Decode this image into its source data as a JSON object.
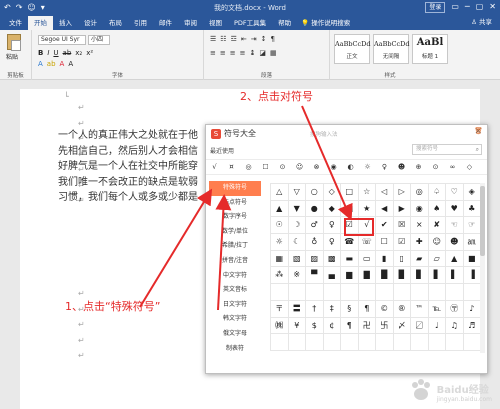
{
  "window": {
    "qat": [
      "↶",
      "↷",
      "☺",
      "▾"
    ],
    "title": "我的文档.docx - Word",
    "login": "登录",
    "controls": [
      "▭",
      "─",
      "▢",
      "✕"
    ]
  },
  "ribbon_tabs": [
    {
      "label": "文件"
    },
    {
      "label": "开始",
      "active": true
    },
    {
      "label": "插入"
    },
    {
      "label": "设计"
    },
    {
      "label": "布局"
    },
    {
      "label": "引用"
    },
    {
      "label": "邮件"
    },
    {
      "label": "审阅"
    },
    {
      "label": "视图"
    },
    {
      "label": "PDF工具集"
    },
    {
      "label": "帮助"
    }
  ],
  "tell_me": "操作说明搜索",
  "share": "共享",
  "ribbon": {
    "clipboard_label": "剪贴板",
    "paste_label": "粘贴",
    "font_name": "Segoe UI Syr",
    "font_size": "小四",
    "font_group_label": "字体",
    "paragraph_group_label": "段落",
    "styles": [
      {
        "sample": "AaBbCcDd",
        "name": "正文"
      },
      {
        "sample": "AaBbCcDd",
        "name": "无间隔"
      },
      {
        "sample": "AaBl",
        "name": "标题 1"
      }
    ],
    "styles_group_label": "样式"
  },
  "document": {
    "lines": [
      "一个人的真正伟大之处就在于他",
      "先相信自己，然后别人才会相信",
      "好脾气是一个人在社交中所能穿",
      "我们唯一不会改正的缺点是软弱",
      "习惯，我们每个人或多或少都是"
    ],
    "para_marks": [
      "↵",
      "↵",
      "↵",
      "↵",
      "↵",
      "↵",
      "↵",
      "↵",
      "↵",
      "↵",
      "↵",
      "↵",
      "↵",
      "↵",
      "↵",
      "↵",
      "↵"
    ]
  },
  "dialog": {
    "title": "符号大全",
    "input_hint": "搜狗输入法",
    "close": "✕",
    "recent_label": "最近使用",
    "search_placeholder": "搜索符号",
    "recent_symbols": [
      "√",
      "¤",
      "◎",
      "☐",
      "⊙",
      "☺",
      "⊗",
      "◉",
      "◐",
      "☼",
      "♀",
      "☻",
      "⊕",
      "⊙",
      "∞",
      "◇"
    ],
    "categories": [
      {
        "label": "特殊符号",
        "active": true
      },
      {
        "label": "标点符号"
      },
      {
        "label": "数字序号"
      },
      {
        "label": "数学/单位"
      },
      {
        "label": "希腊/拉丁"
      },
      {
        "label": "拼音/注音"
      },
      {
        "label": "中文字符"
      },
      {
        "label": "英文音标"
      },
      {
        "label": "日文字符"
      },
      {
        "label": "韩文字符"
      },
      {
        "label": "俄文字母"
      },
      {
        "label": "制表符"
      }
    ],
    "symbols": [
      [
        "△",
        "▽",
        "○",
        "◇",
        "□",
        "☆",
        "◁",
        "▷",
        "◎",
        "♤",
        "♡",
        "◈"
      ],
      [
        "▲",
        "▼",
        "●",
        "◆",
        "■",
        "★",
        "◀",
        "▶",
        "◉",
        "♠",
        "♥",
        "♣"
      ],
      [
        "☉",
        "☽",
        "♂",
        "♀",
        "☑",
        "√",
        "✔",
        "☒",
        "×",
        "✘",
        "☜",
        "☞"
      ],
      [
        "☼",
        "☾",
        "♁",
        "♀",
        "☎",
        "☏",
        "☐",
        "☑",
        "✚",
        "☺",
        "☻",
        "㏂"
      ],
      [
        "▦",
        "▧",
        "▨",
        "▩",
        "▬",
        "▭",
        "▮",
        "▯",
        "▰",
        "▱",
        "▲",
        "■"
      ],
      [
        "⁂",
        "※",
        "▀",
        "▄",
        "▆",
        "▇",
        "█",
        "▉",
        "▊",
        "▋",
        "▌",
        "▐"
      ],
      [
        "",
        "",
        "",
        "",
        "",
        "",
        "",
        "",
        "",
        "",
        "",
        ""
      ],
      [
        "〒",
        "〓",
        "†",
        "‡",
        "§",
        "¶",
        "©",
        "®",
        "™",
        "℡",
        "〶",
        "♪"
      ],
      [
        "㈱",
        "¥",
        "$",
        "¢",
        "¶",
        "卍",
        "卐",
        "〆",
        "〼",
        "♩",
        "♫",
        "♬"
      ],
      [
        "",
        "",
        "",
        "",
        "",
        "",
        "",
        "",
        "",
        "",
        "",
        ""
      ]
    ],
    "highlighted": [
      "√",
      "✔"
    ]
  },
  "annotations": {
    "step1": "1、点击“特殊符号”",
    "step2": "2、点击对符号"
  },
  "watermark": {
    "text": "Baidu经验",
    "url": "jingyan.baidu.com"
  },
  "colors": {
    "word_blue": "#2b579a",
    "annotation_red": "#e52a2a",
    "category_active": "#ff7e4e"
  }
}
